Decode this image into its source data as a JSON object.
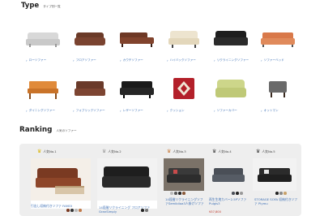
{
  "type_section": {
    "title": "Type",
    "subtitle": "タイプ別一覧",
    "items": [
      {
        "label": "ローソファー",
        "icon": "low-sofa-icon"
      },
      {
        "label": "フロアソファー",
        "icon": "floor-sofa-icon"
      },
      {
        "label": "カウチソファー",
        "icon": "couch-sofa-icon"
      },
      {
        "label": "ハイバックソファー",
        "icon": "highback-sofa-icon"
      },
      {
        "label": "リクライニングソファー",
        "icon": "reclining-sofa-icon"
      },
      {
        "label": "ソファーベッド",
        "icon": "sofa-bed-icon"
      },
      {
        "label": "ダイニングソファー",
        "icon": "dining-sofa-icon"
      },
      {
        "label": "フォブリックソファー",
        "icon": "fabric-sofa-icon"
      },
      {
        "label": "レザーソファー",
        "icon": "leather-sofa-icon"
      },
      {
        "label": "クッション",
        "icon": "cushion-icon"
      },
      {
        "label": "ソファーカバー",
        "icon": "sofa-cover-icon"
      },
      {
        "label": "オットマン",
        "icon": "ottoman-icon"
      }
    ]
  },
  "ranking_section": {
    "title": "Ranking",
    "subtitle": "人気のソファー",
    "items": [
      {
        "rank": "人気No.1",
        "name": "引出し収納付きソファ FAMOI",
        "price": ""
      },
      {
        "rank": "人気No.2",
        "name": "14段階リクライニング フロアソファ GranSimply",
        "price": ""
      },
      {
        "rank": "人気No.3",
        "name": "14段階リクライニングソファSemibiloa3人掛けソファ",
        "price": ""
      },
      {
        "rank": "人気No.4",
        "name": "再生生地カバー2.5Pソファ Pulgis3",
        "price": "¥37,800"
      },
      {
        "rank": "人気No.5",
        "name": "STORAGE SOFA 収納付きソファ Plymu",
        "price": ""
      }
    ]
  }
}
